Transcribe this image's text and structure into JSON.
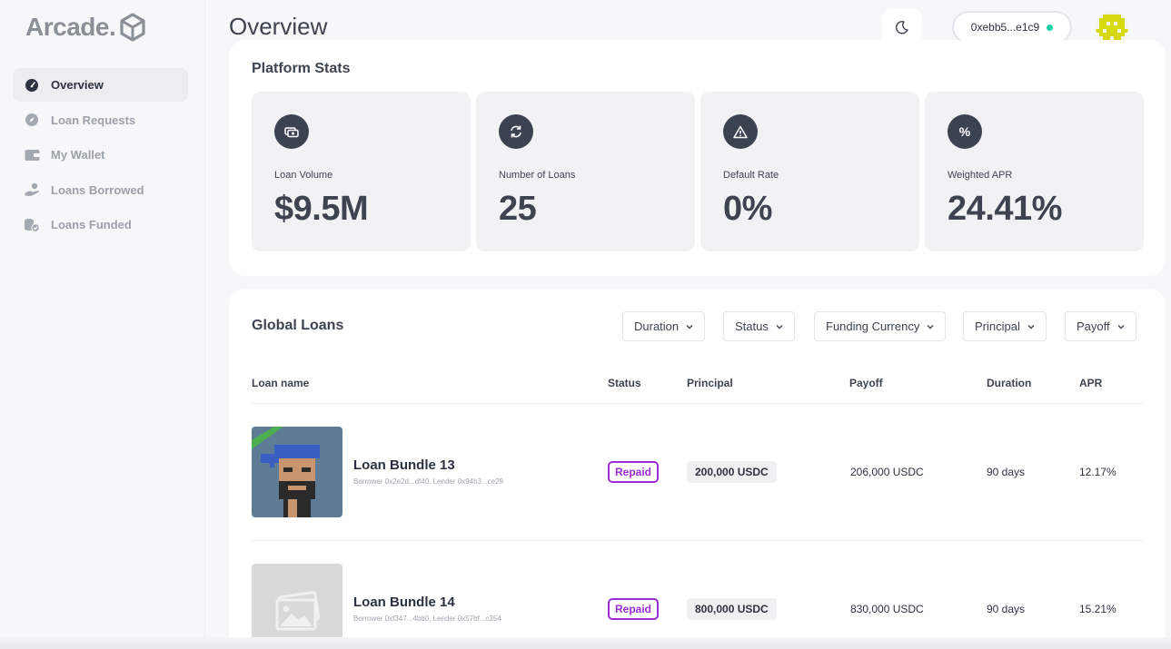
{
  "app": {
    "logo_text": "Arcade."
  },
  "sidebar": {
    "items": [
      {
        "label": "Overview",
        "icon": "gauge-icon",
        "active": true
      },
      {
        "label": "Loan Requests",
        "icon": "compass-icon"
      },
      {
        "label": "My Wallet",
        "icon": "wallet-icon"
      },
      {
        "label": "Loans Borrowed",
        "icon": "hand-coin-icon"
      },
      {
        "label": "Loans Funded",
        "icon": "coins-check-icon"
      }
    ]
  },
  "header": {
    "title": "Overview",
    "wallet_address": "0xebb5...e1c9",
    "status_color": "#15d3a6"
  },
  "platform_stats": {
    "title": "Platform Stats",
    "tiles": [
      {
        "label": "Loan Volume",
        "value": "$9.5M",
        "icon": "money-icon"
      },
      {
        "label": "Number of Loans",
        "value": "25",
        "icon": "refresh-icon"
      },
      {
        "label": "Default Rate",
        "value": "0%",
        "icon": "warning-icon"
      },
      {
        "label": "Weighted APR",
        "value": "24.41%",
        "icon": "percent-icon",
        "icon_text": "%"
      }
    ]
  },
  "global_loans": {
    "title": "Global Loans",
    "filters": [
      "Duration",
      "Status",
      "Funding Currency",
      "Principal",
      "Payoff"
    ],
    "columns": [
      "Loan name",
      "Status",
      "Principal",
      "Payoff",
      "Duration",
      "APR"
    ],
    "rows": [
      {
        "name": "Loan Bundle 13",
        "sub": "Borrower 0x2e2d...df40, Lender 0x94b3...ce29",
        "status": "Repaid",
        "principal": "200,000 USDC",
        "payoff": "206,000 USDC",
        "duration": "90 days",
        "apr": "12.17%"
      },
      {
        "name": "Loan Bundle 14",
        "sub": "Borrower 0xf347...4bb0, Lender 0x57bf...c354",
        "status": "Repaid",
        "principal": "800,000 USDC",
        "payoff": "830,000 USDC",
        "duration": "90 days",
        "apr": "15.21%"
      }
    ]
  },
  "colors": {
    "accent": "#9b2cd4",
    "dark_icon": "#3b4250"
  }
}
